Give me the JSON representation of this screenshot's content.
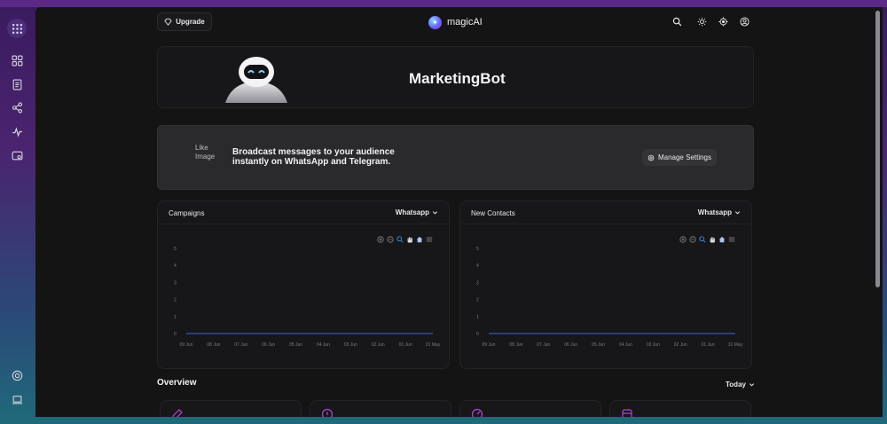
{
  "app": {
    "brand": "magicAI"
  },
  "header": {
    "upgrade_label": "Upgrade",
    "icons": [
      "search-icon",
      "theme-toggle-icon",
      "crosshair-icon",
      "user-avatar-icon"
    ]
  },
  "sidebar": {
    "items": [
      "apps-grid-icon",
      "dashboard-icon",
      "document-icon",
      "share-icon",
      "activity-icon",
      "settings-icon",
      "support-icon",
      "laptop-icon"
    ]
  },
  "hero": {
    "title": "MarketingBot"
  },
  "broadcast": {
    "image_alt": "Like Image",
    "text": "Broadcast messages to your audience instantly on WhatsApp and Telegram.",
    "manage_label": "Manage Settings"
  },
  "cards": [
    {
      "title": "Campaigns",
      "channel": "Whatsapp"
    },
    {
      "title": "New Contacts",
      "channel": "Whatsapp"
    }
  ],
  "chart_data": [
    {
      "type": "line",
      "title": "Campaigns",
      "categories": [
        "09 Jun",
        "08 Jun",
        "07 Jun",
        "06 Jun",
        "05 Jun",
        "04 Jun",
        "03 Jun",
        "02 Jun",
        "01 Jun",
        "31 May"
      ],
      "series": [
        {
          "values": [
            0,
            0,
            0,
            0,
            0,
            0,
            0,
            0,
            0,
            0
          ]
        }
      ],
      "yticks": [
        0,
        1,
        2,
        3,
        4,
        5
      ],
      "ylim": [
        0,
        5
      ],
      "grid": false,
      "color": "#3b6fd8"
    },
    {
      "type": "line",
      "title": "New Contacts",
      "categories": [
        "09 Jun",
        "08 Jun",
        "07 Jun",
        "06 Jun",
        "05 Jun",
        "04 Jun",
        "03 Jun",
        "02 Jun",
        "01 Jun",
        "31 May"
      ],
      "series": [
        {
          "values": [
            0,
            0,
            0,
            0,
            0,
            0,
            0,
            0,
            0,
            0
          ]
        }
      ],
      "yticks": [
        0,
        1,
        2,
        3,
        4,
        5
      ],
      "ylim": [
        0,
        5
      ],
      "grid": false,
      "color": "#3b6fd8"
    }
  ],
  "overview": {
    "title": "Overview",
    "period": "Today",
    "cards": [
      {
        "icon": "edit-icon",
        "color": "#b048d8"
      },
      {
        "icon": "info-icon",
        "color": "#b048d8"
      },
      {
        "icon": "gauge-icon",
        "color": "#b048d8"
      },
      {
        "icon": "database-icon",
        "color": "#b048d8"
      }
    ]
  }
}
